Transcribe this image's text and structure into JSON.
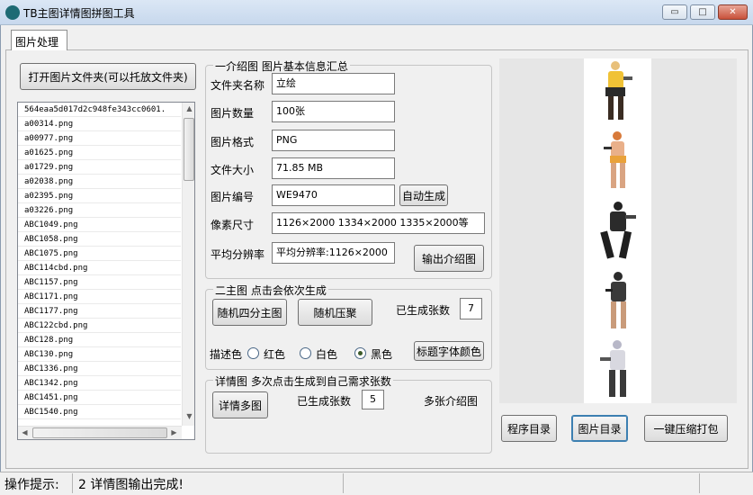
{
  "window": {
    "title": "TB主图详情图拼图工具",
    "controls": {
      "minimize": "▭",
      "maximize": "□",
      "close": "✕"
    }
  },
  "tabs": [
    {
      "label": "图片处理"
    }
  ],
  "left": {
    "open_folder_button": "打开图片文件夹(可以托放文件夹)",
    "files": [
      "564eaa5d017d2c948fe343cc0601.",
      "a00314.png",
      "a00977.png",
      "a01625.png",
      "a01729.png",
      "a02038.png",
      "a02395.png",
      "a03226.png",
      "ABC1049.png",
      "ABC1058.png",
      "ABC1075.png",
      "ABC114cbd.png",
      "ABC1157.png",
      "ABC1171.png",
      "ABC1177.png",
      "ABC122cbd.png",
      "ABC128.png",
      "ABC130.png",
      "ABC1336.png",
      "ABC1342.png",
      "ABC1451.png",
      "ABC1540.png"
    ]
  },
  "info_group": {
    "title": "一介绍图 图片基本信息汇总",
    "rows": [
      {
        "label": "文件夹名称",
        "value": "立绘"
      },
      {
        "label": "图片数量",
        "value": "100张"
      },
      {
        "label": "图片格式",
        "value": "PNG"
      },
      {
        "label": "文件大小",
        "value": "71.85 MB"
      },
      {
        "label": "图片编号",
        "value": "WE9470"
      },
      {
        "label": "像素尺寸",
        "value": "1126×2000 1334×2000 1335×2000等"
      },
      {
        "label": "平均分辨率",
        "value": "平均分辨率:1126×2000"
      }
    ],
    "auto_generate_button": "自动生成",
    "export_intro_button": "输出介绍图"
  },
  "main_group": {
    "title": "二主图 点击会依次生成",
    "random_four_button": "随机四分主图",
    "random_cluster_button": "随机压聚",
    "generated_label": "已生成张数",
    "generated_count": "7",
    "desc_color_label": "描述色",
    "colors": [
      {
        "label": "红色",
        "selected": false
      },
      {
        "label": "白色",
        "selected": false
      },
      {
        "label": "黑色",
        "selected": true
      }
    ],
    "title_font_color_button": "标题字体颜色"
  },
  "detail_group": {
    "title": "详情图 多次点击生成到自己需求张数",
    "multi_detail_button": "详情多图",
    "generated_label": "已生成张数",
    "generated_count": "5",
    "multi_intro_label": "多张介绍图"
  },
  "bottom_buttons": {
    "program_dir": "程序目录",
    "image_dir": "图片目录",
    "compress_pack": "一键压缩打包"
  },
  "status": {
    "label": "操作提示:",
    "message": "2 详情图输出完成!"
  },
  "colors": {
    "focus_blue": "#3c7fb1",
    "radio_dot": "#3d5b2a"
  }
}
